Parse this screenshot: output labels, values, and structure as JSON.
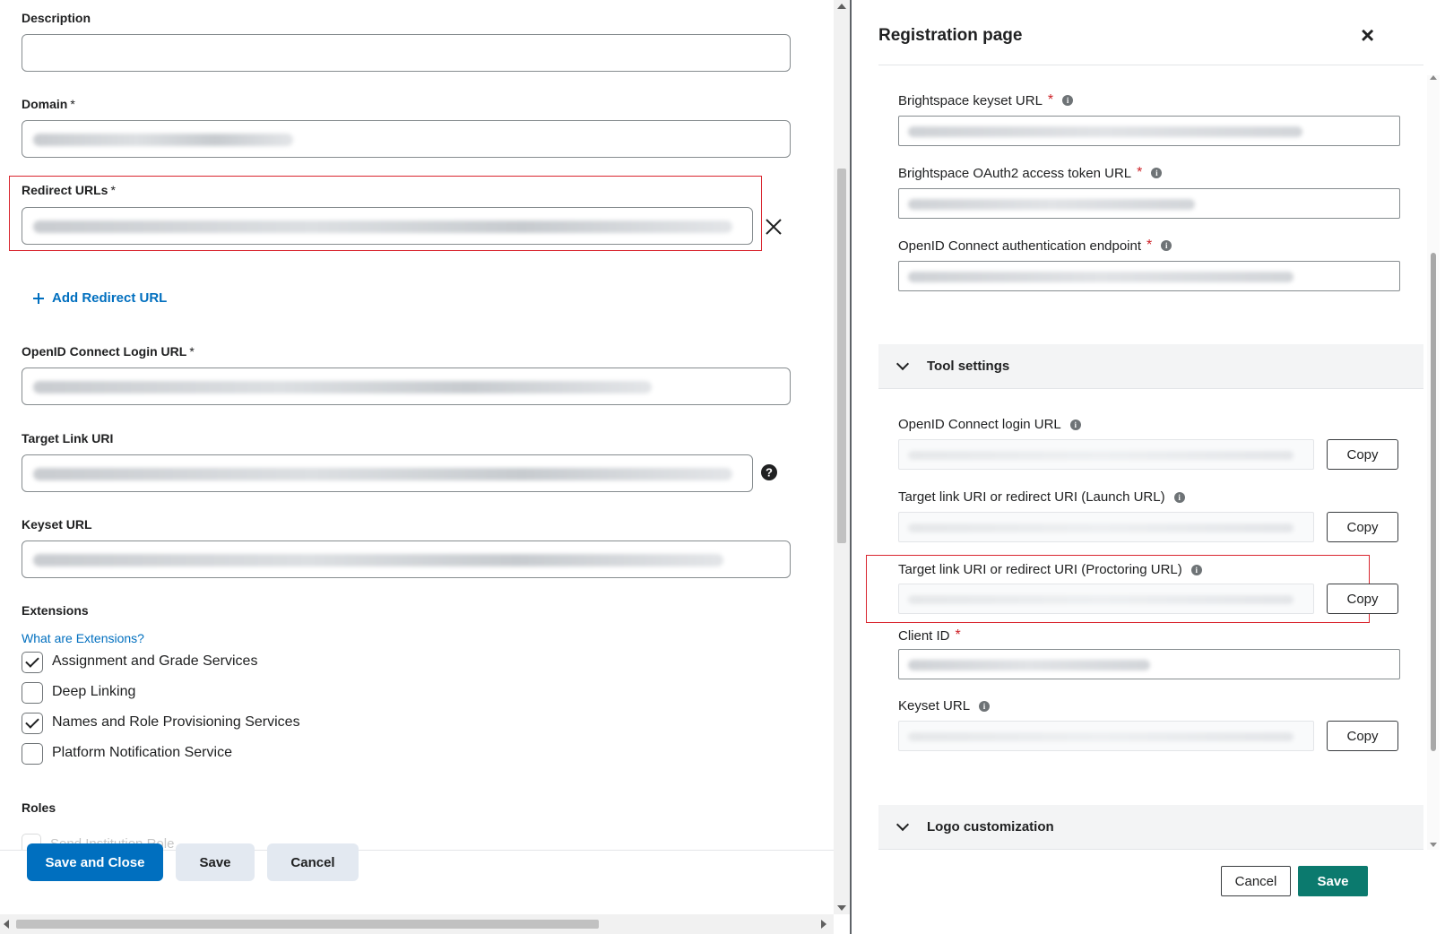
{
  "left_form": {
    "description_label": "Description",
    "domain_label": "Domain",
    "redirect_urls_label": "Redirect URLs",
    "add_redirect_url": "Add Redirect URL",
    "openid_login_label": "OpenID Connect Login URL",
    "target_link_label": "Target Link URI",
    "keyset_label": "Keyset URL",
    "extensions_label": "Extensions",
    "extensions_help_link": "What are Extensions?",
    "extensions": [
      {
        "label": "Assignment and Grade Services",
        "checked": true
      },
      {
        "label": "Deep Linking",
        "checked": false
      },
      {
        "label": "Names and Role Provisioning Services",
        "checked": true
      },
      {
        "label": "Platform Notification Service",
        "checked": false
      }
    ],
    "roles_label": "Roles",
    "roles_partial_item": "Send Institution Role",
    "required_marker": "*"
  },
  "left_footer": {
    "save_and_close": "Save and Close",
    "save": "Save",
    "cancel": "Cancel"
  },
  "dialog": {
    "title": "Registration page",
    "close_glyph": "×",
    "fields_top": [
      {
        "label": "Brightspace keyset URL",
        "required": true
      },
      {
        "label": "Brightspace OAuth2 access token URL",
        "required": true
      },
      {
        "label": "OpenID Connect authentication endpoint",
        "required": true
      }
    ],
    "tool_settings_title": "Tool settings",
    "tool_fields": [
      {
        "label": "OpenID Connect login URL",
        "copy": "Copy"
      },
      {
        "label": "Target link URI or redirect URI (Launch URL)",
        "copy": "Copy"
      },
      {
        "label": "Target link URI or redirect URI (Proctoring URL)",
        "copy": "Copy"
      }
    ],
    "client_id_label": "Client ID",
    "keyset_label": "Keyset URL",
    "keyset_copy": "Copy",
    "logo_section_title": "Logo customization",
    "required_marker": "*",
    "info_glyph": "i",
    "footer": {
      "cancel": "Cancel",
      "save": "Save"
    }
  },
  "colors": {
    "primary_blue": "#006fbf",
    "link_blue": "#006fbf",
    "teal_save": "#0b7a6e",
    "highlight_red": "#d9262f",
    "required_red": "#cd2026"
  }
}
